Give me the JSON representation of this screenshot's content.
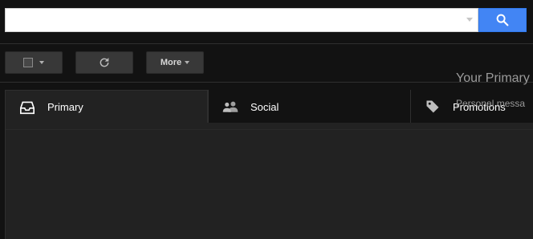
{
  "search": {
    "value": "",
    "placeholder": "",
    "button_icon": "search-icon",
    "dropdown_icon": "caret-down-icon"
  },
  "toolbar": {
    "select_icon": "checkbox-icon",
    "refresh_icon": "refresh-icon",
    "more_label": "More"
  },
  "tabs": [
    {
      "label": "Primary",
      "icon": "inbox-icon",
      "selected": true
    },
    {
      "label": "Social",
      "icon": "people-icon",
      "selected": false
    },
    {
      "label": "Promotions",
      "icon": "tag-icon",
      "selected": false
    }
  ],
  "empty_state": {
    "title": "Your Primary",
    "text": "Personal messa"
  },
  "colors": {
    "background": "#121212",
    "search_button": "#4285f4",
    "tab_selected_bg": "#222222"
  }
}
